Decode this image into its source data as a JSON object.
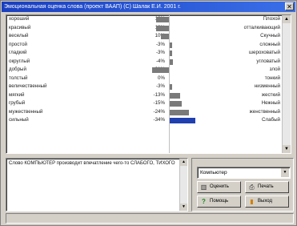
{
  "window": {
    "title": "Эмоциональная оценка слова (проект ВААП) (С) Шалак Е.И. 2001 г.",
    "close_glyph": "✕"
  },
  "rows": [
    {
      "left": "хороший",
      "pct": "16%",
      "value": 16,
      "right": "Плохой",
      "selected": false
    },
    {
      "left": "красивый",
      "pct": "16%",
      "value": 16,
      "right": "отталкивающий",
      "selected": false
    },
    {
      "left": "веселый",
      "pct": "10%",
      "value": 10,
      "right": "Скучный",
      "selected": false
    },
    {
      "left": "простой",
      "pct": "-3%",
      "value": -3,
      "right": "сложный",
      "selected": false
    },
    {
      "left": "гладкий",
      "pct": "-3%",
      "value": -3,
      "right": "шероховатый",
      "selected": false
    },
    {
      "left": "округлый",
      "pct": "-4%",
      "value": -4,
      "right": "угловатый",
      "selected": false
    },
    {
      "left": "добрый",
      "pct": "21%",
      "value": 21,
      "right": "злой",
      "selected": false
    },
    {
      "left": "толстый",
      "pct": "0%",
      "value": 0,
      "right": "тонкий",
      "selected": false
    },
    {
      "left": "величественный",
      "pct": "-3%",
      "value": -3,
      "right": "низменный",
      "selected": false
    },
    {
      "left": "мягкий",
      "pct": "-13%",
      "value": -13,
      "right": "жесткий",
      "selected": false
    },
    {
      "left": "грубый",
      "pct": "-15%",
      "value": -15,
      "right": "Нежный",
      "selected": false
    },
    {
      "left": "мужественный",
      "pct": "-24%",
      "value": -24,
      "right": "женственный",
      "selected": false
    },
    {
      "left": "сильный",
      "pct": "-34%",
      "value": -34,
      "right": "Слабый",
      "selected": true
    }
  ],
  "memo": {
    "text": "Слово КОМПЬЮТЕР производит впечатление чего-то СЛАБОГО, ТИХОГО"
  },
  "combo": {
    "value": "Компьютер"
  },
  "buttons": {
    "evaluate": "Оценить",
    "print": "Печать",
    "help": "Помощь",
    "exit": "Выход"
  },
  "icons": {
    "scroll_up": "▲",
    "scroll_down": "▼",
    "evaluate": "▥",
    "print": "⎙",
    "help": "?",
    "exit": "▮"
  },
  "colors": {
    "title_bar": "#1a3fbf",
    "bar": "#7a7a7a",
    "selected_bar": "#2040b0"
  }
}
